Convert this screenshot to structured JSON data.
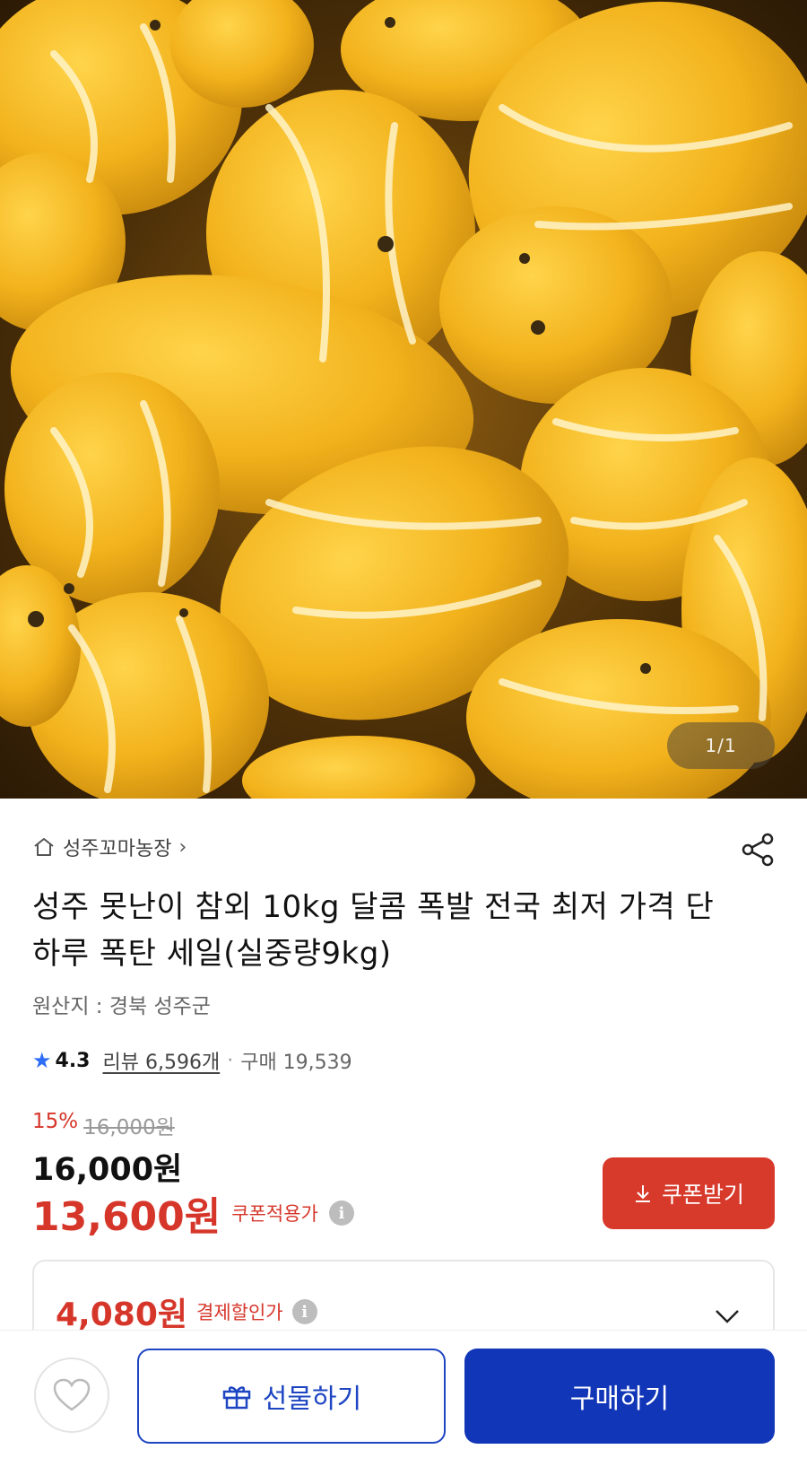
{
  "gallery": {
    "pager": "1/1",
    "image_alt": "참외 사진"
  },
  "store": {
    "name": "성주꼬마농장",
    "chevron": "›"
  },
  "product": {
    "title": "성주 못난이 참외  10kg 달콤 폭발 전국 최저 가격 단 하루 폭탄 세일(실중량9kg)",
    "origin": "원산지 : 경북 성주군"
  },
  "rating": {
    "score": "4.3",
    "review_label": "리뷰 6,596개",
    "purchase_label": "구매 19,539"
  },
  "pricing": {
    "discount_pct": "15%",
    "original_price": "16,000원",
    "price": "16,000원",
    "coupon_price": "13,600원",
    "coupon_label": "쿠폰적용가",
    "coupon_button": "쿠폰받기",
    "pay_price": "4,080원",
    "pay_label": "결제할인가"
  },
  "actions": {
    "gift_label": "선물하기",
    "buy_label": "구매하기"
  },
  "colors": {
    "accent_red": "#d7392b",
    "brand_blue": "#1236b8",
    "star_blue": "#2d6cf5"
  }
}
